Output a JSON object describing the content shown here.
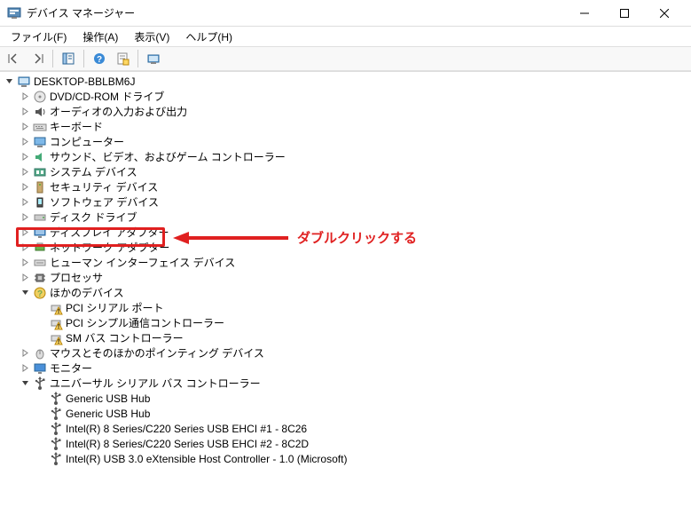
{
  "title": "デバイス マネージャー",
  "menu": {
    "file": "ファイル(F)",
    "action": "操作(A)",
    "view": "表示(V)",
    "help": "ヘルプ(H)"
  },
  "root": "DESKTOP-BBLBM6J",
  "nodes": [
    {
      "label": "DVD/CD-ROM ドライブ",
      "icon": "disc",
      "expander": "right"
    },
    {
      "label": "オーディオの入力および出力",
      "icon": "audio",
      "expander": "right"
    },
    {
      "label": "キーボード",
      "icon": "keyboard",
      "expander": "right"
    },
    {
      "label": "コンピューター",
      "icon": "computer",
      "expander": "right"
    },
    {
      "label": "サウンド、ビデオ、およびゲーム コントローラー",
      "icon": "sound",
      "expander": "right"
    },
    {
      "label": "システム デバイス",
      "icon": "system",
      "expander": "right"
    },
    {
      "label": "セキュリティ デバイス",
      "icon": "security",
      "expander": "right"
    },
    {
      "label": "ソフトウェア デバイス",
      "icon": "software",
      "expander": "right"
    },
    {
      "label": "ディスク ドライブ",
      "icon": "disk",
      "expander": "right"
    },
    {
      "label": "ディスプレイ アダプター",
      "icon": "display",
      "expander": "right",
      "highlighted": true
    },
    {
      "label": "ネットワーク アダプター",
      "icon": "network",
      "expander": "right"
    },
    {
      "label": "ヒューマン インターフェイス デバイス",
      "icon": "hid",
      "expander": "right"
    },
    {
      "label": "プロセッサ",
      "icon": "cpu",
      "expander": "right"
    },
    {
      "label": "ほかのデバイス",
      "icon": "other",
      "expander": "down",
      "children": [
        {
          "label": "PCI シリアル ポート",
          "icon": "warn"
        },
        {
          "label": "PCI シンプル通信コントローラー",
          "icon": "warn"
        },
        {
          "label": "SM バス コントローラー",
          "icon": "warn"
        }
      ]
    },
    {
      "label": "マウスとそのほかのポインティング デバイス",
      "icon": "mouse",
      "expander": "right"
    },
    {
      "label": "モニター",
      "icon": "monitor",
      "expander": "right"
    },
    {
      "label": "ユニバーサル シリアル バス コントローラー",
      "icon": "usb",
      "expander": "down",
      "children": [
        {
          "label": "Generic USB Hub",
          "icon": "usb"
        },
        {
          "label": "Generic USB Hub",
          "icon": "usb"
        },
        {
          "label": "Intel(R) 8 Series/C220 Series USB EHCI #1 - 8C26",
          "icon": "usb"
        },
        {
          "label": "Intel(R) 8 Series/C220 Series USB EHCI #2 - 8C2D",
          "icon": "usb"
        },
        {
          "label": "Intel(R) USB 3.0 eXtensible Host Controller - 1.0 (Microsoft)",
          "icon": "usb"
        }
      ]
    }
  ],
  "annotation": {
    "text": "ダブルクリックする",
    "highlight_color": "#e02020"
  }
}
